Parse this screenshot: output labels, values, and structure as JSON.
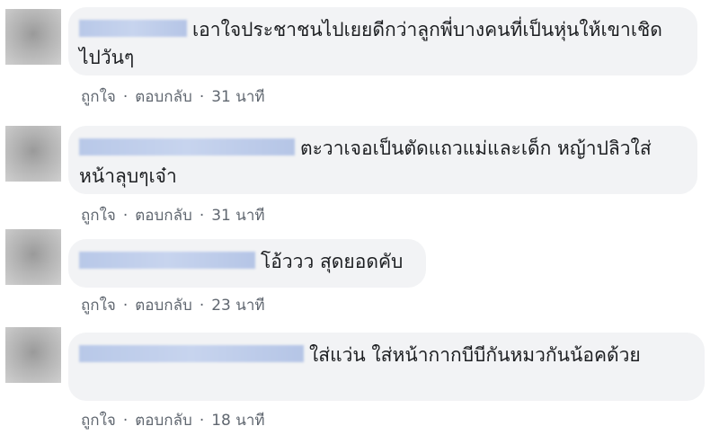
{
  "comments": [
    {
      "text": "เอาใจประชาชนไปเยยดีกว่าลูกพี่บางคนที่เป็นหุ่นให้เขาเชิดไปวันๆ",
      "like": "ถูกใจ",
      "reply": "ตอบกลับ",
      "time": "31 นาที"
    },
    {
      "text": "ตะวาเจอเป็นตัดแถวแม่และเด็ก หญ้าปลิวใส่หน้าลุบๆเจ๋า",
      "like": "ถูกใจ",
      "reply": "ตอบกลับ",
      "time": "31 นาที"
    },
    {
      "text": "โอ้ววว สุดยอดคับ",
      "like": "ถูกใจ",
      "reply": "ตอบกลับ",
      "time": "23 นาที"
    },
    {
      "text": "ใส่แว่น ใส่หน้ากากบีบีกันหมวกันน้อคด้วย",
      "like": "ถูกใจ",
      "reply": "ตอบกลับ",
      "time": "18 นาที"
    }
  ],
  "separator": "·"
}
